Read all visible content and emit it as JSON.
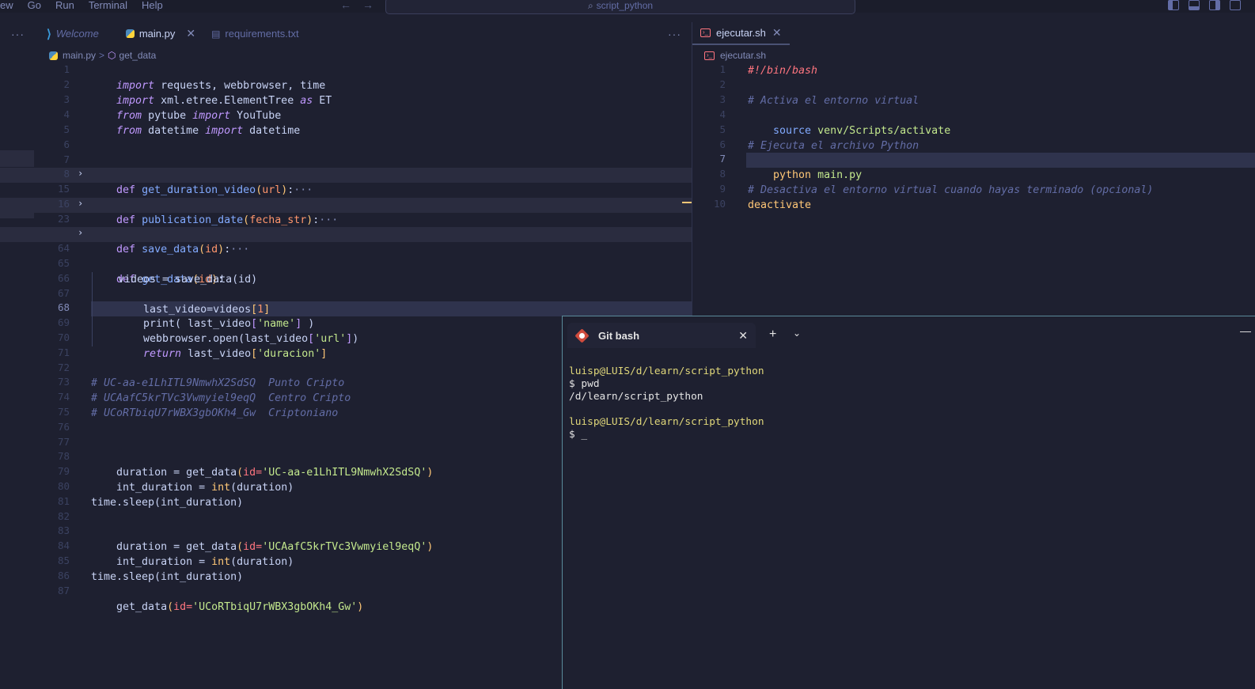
{
  "menubar": {
    "items": [
      "ew",
      "Go",
      "Run",
      "Terminal",
      "Help"
    ],
    "search_text": "script_python",
    "nav_back": "←",
    "nav_forward": "→"
  },
  "left_tabs": {
    "more": "···",
    "tabs": [
      {
        "label": "Welcome",
        "icon": "vscode-icon"
      },
      {
        "label": "main.py",
        "icon": "python-icon",
        "close": "✕"
      },
      {
        "label": "requirements.txt",
        "icon": "text-file-icon"
      }
    ],
    "more_right": "···"
  },
  "right_tabs": {
    "tabs": [
      {
        "label": "ejecutar.sh",
        "icon": "shell-icon",
        "close": "✕"
      }
    ]
  },
  "breadcrumb_left": {
    "file": "main.py",
    "symbol": "get_data",
    "sep": ">"
  },
  "breadcrumb_right": {
    "file": "ejecutar.sh"
  },
  "main_py": {
    "line_numbers": [
      "1",
      "2",
      "3",
      "4",
      "5",
      "6",
      "7",
      "8",
      "15",
      "16",
      "23",
      "64",
      "65",
      "66",
      "67",
      "68",
      "69",
      "70",
      "71",
      "72",
      "73",
      "74",
      "75",
      "76",
      "77",
      "78",
      "79",
      "80",
      "81",
      "82",
      "83",
      "84",
      "85",
      "86",
      "87"
    ],
    "import_1a": "import",
    "import_1b": " requests, webbrowser, time",
    "import_2a": "import",
    "import_2b": " xml.etree.ElementTree ",
    "import_2c": "as",
    "import_2d": " ET",
    "import_3a": "from",
    "import_3b": " pytube ",
    "import_3c": "import",
    "import_3d": " YouTube",
    "import_4a": "from",
    "import_4b": " datetime ",
    "import_4c": "import",
    "import_4d": " datetime",
    "def": "def",
    "fn1": "get_duration_video",
    "fn1_param": "url",
    "fn2": "publication_date",
    "fn2_param": "fecha_str",
    "fn3": "save_data",
    "fn3_param": "id",
    "fn4": "get_data",
    "fn4_param": "id",
    "ellipsis": "···",
    "l66": "videos = save_data(id)",
    "l67a": "last_video=videos",
    "l67b": "1",
    "l68a": "print( last_video",
    "l68b": "'name'",
    "l68c": " )",
    "l69a": "webbrowser.open(last_video",
    "l69b": "'url'",
    "l69c": ")",
    "l70a": "return",
    "l70b": " last_video",
    "l70c": "'duracion'",
    "c73": "# UC-aa-e1LhITL9NmwhX2SdSQ  Punto Cripto",
    "c74": "# UCAafC5krTVc3Vwmyiel9eqQ  Centro Cripto",
    "c75": "# UCoRTbiqU7rWBX3gbOKh4_Gw  Criptoniano",
    "l78a": "duration = get_data",
    "l78b": "id=",
    "l78c": "'UC-aa-e1LhITL9NmwhX2SdSQ'",
    "l79a": "int_duration = ",
    "l79b": "int",
    "l79c": "(duration)",
    "l81": "time.sleep(int_duration)",
    "l83a": "duration = get_data",
    "l83b": "id=",
    "l83c": "'UCAafC5krTVc3Vwmyiel9eqQ'",
    "l84a": "int_duration = ",
    "l84b": "int",
    "l84c": "(duration)",
    "l86": "time.sleep(int_duration)",
    "l87a": "get_data",
    "l87b": "id=",
    "l87c": "'UCoRTbiqU7rWBX3gbOKh4_Gw'"
  },
  "ejecutar_sh": {
    "line_numbers": [
      "1",
      "2",
      "3",
      "4",
      "5",
      "6",
      "7",
      "8",
      "9",
      "10"
    ],
    "l1": "#!/bin/bash",
    "l3": "# Activa el entorno virtual",
    "l4a": "source",
    "l4b": " venv/Scripts/activate",
    "l6": "# Ejecuta el archivo Python",
    "l7a": "python",
    "l7b": " main.py",
    "l9": "# Desactiva el entorno virtual cuando hayas terminado (opcional)",
    "l10": "deactivate"
  },
  "terminal": {
    "tab_label": "Git bash",
    "close": "✕",
    "plus": "+",
    "chevron": "⌄",
    "minimize": "—",
    "lines": [
      "luisp@LUIS/d/learn/script_python",
      "$ pwd",
      "/d/learn/script_python",
      "",
      "luisp@LUIS/d/learn/script_python",
      "$ _"
    ]
  }
}
